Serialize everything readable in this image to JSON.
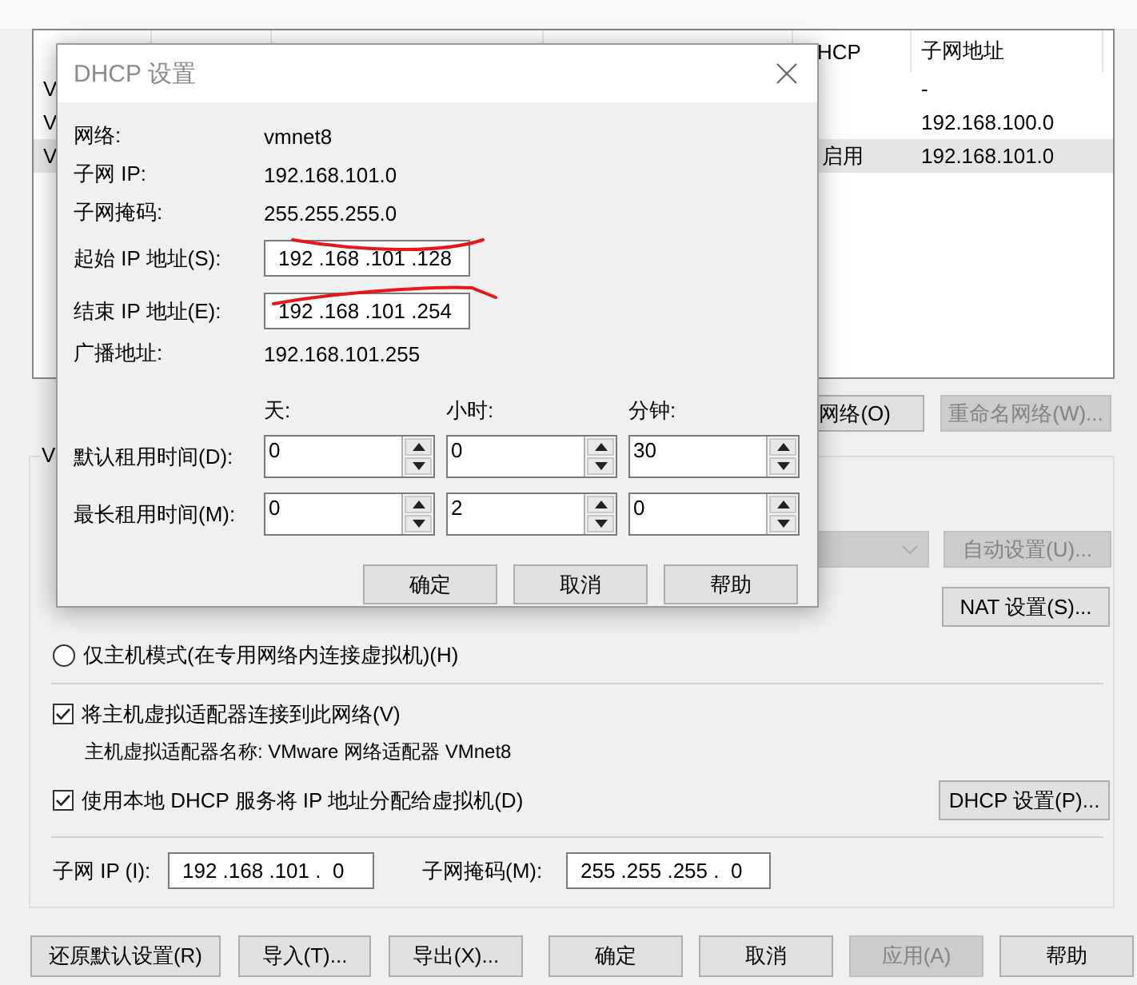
{
  "network_table": {
    "columns": [
      "HCP",
      "子网地址"
    ],
    "rows": [
      {
        "name": "V",
        "subnet": "-",
        "selected": false
      },
      {
        "name": "V",
        "subnet": "192.168.100.0",
        "selected": false
      },
      {
        "name": "V",
        "dhcp": "启用",
        "subnet": "192.168.101.0",
        "selected": true
      }
    ]
  },
  "network_buttons": [
    {
      "label": "网络(O)",
      "disabled": false
    },
    {
      "label": "重命名网络(W)...",
      "disabled": true
    }
  ],
  "vmnet_info": {
    "legend": "V",
    "dropdown": {
      "disabled": true
    },
    "auto_button": {
      "label": "自动设置(U)...",
      "disabled": true
    },
    "nat_button": {
      "label": "NAT 设置(S)...",
      "disabled": false
    },
    "host_only_radio": {
      "label": "仅主机模式(在专用网络内连接虚拟机)(H)",
      "selected": false
    },
    "connect_adapter": {
      "label": "将主机虚拟适配器连接到此网络(V)",
      "checked": true
    },
    "adapter_name": "主机虚拟适配器名称: VMware 网络适配器 VMnet8",
    "use_dhcp": {
      "label": "使用本地 DHCP 服务将 IP 地址分配给虚拟机(D)",
      "checked": true
    },
    "dhcp_button": {
      "label": "DHCP 设置(P)...",
      "disabled": false
    },
    "subnet_ip": {
      "label": "子网 IP (I):",
      "value": "192 .168 .101 .  0"
    },
    "subnet_mask": {
      "label": "子网掩码(M):",
      "value": "255 .255 .255 .  0"
    }
  },
  "footer_buttons": [
    {
      "label": "还原默认设置(R)",
      "disabled": false
    },
    {
      "label": "导入(T)...",
      "disabled": false
    },
    {
      "label": "导出(X)...",
      "disabled": false
    },
    {
      "label": "确定",
      "disabled": false
    },
    {
      "label": "取消",
      "disabled": false
    },
    {
      "label": "应用(A)",
      "disabled": true
    },
    {
      "label": "帮助",
      "disabled": false
    }
  ],
  "dhcp_dialog": {
    "title": "DHCP 设置",
    "info": [
      {
        "label": "网络:",
        "value": "vmnet8"
      },
      {
        "label": "子网 IP:",
        "value": "192.168.101.0"
      },
      {
        "label": "子网掩码:",
        "value": "255.255.255.0"
      }
    ],
    "ip_fields": [
      {
        "label": "起始 IP 地址(S):",
        "value": "192 .168 .101 .128",
        "underlined": true
      },
      {
        "label": "结束 IP 地址(E):",
        "value": "192 .168 .101 .254",
        "underlined": true
      }
    ],
    "broadcast": {
      "label": "广播地址:",
      "value": "192.168.101.255"
    },
    "lease_units": [
      "天:",
      "小时:",
      "分钟:"
    ],
    "leases": [
      {
        "label": "默认租用时间(D):",
        "values": [
          "0",
          "0",
          "30"
        ]
      },
      {
        "label": "最长租用时间(M):",
        "values": [
          "0",
          "2",
          "0"
        ]
      }
    ],
    "buttons": [
      "确定",
      "取消",
      "帮助"
    ]
  }
}
